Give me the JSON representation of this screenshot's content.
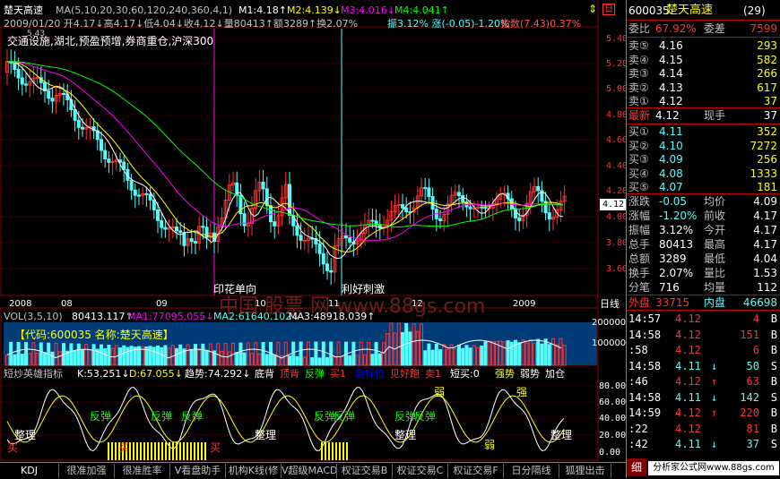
{
  "colors": {
    "up": "#ff3232",
    "down": "#54fcfc",
    "text": "#c0c0c0",
    "yellow": "#ffff00",
    "white": "#ffffff",
    "magenta": "#ff00ff",
    "green": "#00ff00",
    "grid": "#800000",
    "accent": "#ff5050"
  },
  "header": {
    "title": "楚天高速",
    "ma_label": "MA(5,10,20,30,60,120,240,360,4,1)",
    "m1": "M1:4.18↑",
    "m2": "M2:4.139↓",
    "m3": "M3:4.016↓",
    "m4": "M4:4.041↑",
    "ohlc": "2009/01/20 开4.17↓高4.17↓低4.04↓收4.12↓量80413↑额3289↑换2.07%",
    "change": "振3.12% 涨(-0.05)-1.20%",
    "index": "指数(7.43)0.37%",
    "concepts": "交通设施,湖北,预盈预增,券商重仓,沪深300",
    "topleft_val": "5.43"
  },
  "price_axis": [
    "5.40",
    "5.20",
    "5.00",
    "4.80",
    "4.60",
    "4.40",
    "4.20",
    "4.00",
    "3.80",
    "3.60"
  ],
  "current_price_tag": "4.12",
  "annotations": {
    "a1": "印花单向",
    "a2": "利好刺激"
  },
  "date_axis": [
    "2008",
    "08",
    "09",
    "10",
    "11",
    "12",
    "2009"
  ],
  "date_axis_right": "日线",
  "volume": {
    "label": "VOL(3,5,10)",
    "v": "80413.117↑",
    "ma1": "MA1:77095.055↓",
    "ma2": "MA2:61640.102↓",
    "ma3": "MA3:48918.039↑",
    "code_box": "【代码:600035 名称:楚天高速】",
    "axis": [
      "200000",
      "100000"
    ]
  },
  "watermark": "中国 股票 网 www.88gs.com",
  "indicator": {
    "name": "短炒英雄指标",
    "k": "K:53.251↓",
    "d": "D:67.055↓",
    "trend": "趋势:74.292↓",
    "labels": [
      "底背",
      "顶背",
      "反弹",
      "买1",
      "目标位",
      "见好跑",
      "卖1",
      "短买:0",
      "强势",
      "弱势",
      "加仓"
    ],
    "axis": [
      "80.00",
      "60.00",
      "40.00",
      "20.00",
      "0.00"
    ],
    "marks": [
      "反弹",
      "反弹",
      "反弹",
      "反弹",
      "反弹",
      "反弹",
      "反弹",
      "整理",
      "整理",
      "整理",
      "整理",
      "弱",
      "强",
      "弱",
      "买",
      "买",
      "买"
    ]
  },
  "tabs": [
    "KDJ",
    "很准加强",
    "很准胜率",
    "V看盘助手",
    "机构K线(修",
    "V超级MACD",
    "权证交易B",
    "权证交易C",
    "权证交易F",
    "日分隔线",
    "狐狸出击"
  ],
  "right": {
    "code": "600035",
    "name": "楚天高速",
    "count": "(29)",
    "weibi_label": "委比",
    "weibi": "67.92%",
    "weicha_label": "委差",
    "weicha": "7599",
    "sells": [
      {
        "label": "卖⑤",
        "price": "4.16",
        "vol": "293"
      },
      {
        "label": "卖④",
        "price": "4.15",
        "vol": "582"
      },
      {
        "label": "卖③",
        "price": "4.14",
        "vol": "266"
      },
      {
        "label": "卖②",
        "price": "4.13",
        "vol": "617"
      },
      {
        "label": "卖①",
        "price": "4.12",
        "vol": "37"
      }
    ],
    "latest_label": "最新",
    "latest": "4.12",
    "xianshou_label": "现手",
    "xianshou": "37",
    "buys": [
      {
        "label": "买①",
        "price": "4.11",
        "vol": "352"
      },
      {
        "label": "买②",
        "price": "4.10",
        "vol": "7272"
      },
      {
        "label": "买③",
        "price": "4.09",
        "vol": "256"
      },
      {
        "label": "买④",
        "price": "4.08",
        "vol": "1333"
      },
      {
        "label": "买⑤",
        "price": "4.07",
        "vol": "181"
      }
    ],
    "stats": [
      {
        "l1": "涨跌",
        "v1": "-0.05",
        "l2": "均价",
        "v2": "4.09"
      },
      {
        "l1": "涨幅",
        "v1": "-1.20%",
        "l2": "前收",
        "v2": "4.17"
      },
      {
        "l1": "振幅",
        "v1": "3.12%",
        "l2": "今开",
        "v2": "4.17"
      },
      {
        "l1": "总手",
        "v1": "80413",
        "l2": "最高",
        "v2": "4.17"
      },
      {
        "l1": "总额",
        "v1": "3289",
        "l2": "最低",
        "v2": "4.04"
      },
      {
        "l1": "换手",
        "v1": "2.07%",
        "l2": "量比",
        "v2": "1.53"
      },
      {
        "l1": "分笔",
        "v1": "716",
        "l2": "均量",
        "v2": "112"
      }
    ],
    "waipan_label": "外盘",
    "waipan": "33715",
    "neipan_label": "内盘",
    "neipan": "46698",
    "ticks": [
      {
        "t": "14:57",
        "p": "4.12",
        "a": "",
        "v": "4",
        "s": "B"
      },
      {
        "t": "14:58",
        "p": "4.12",
        "a": "",
        "v": "151",
        "s": "B"
      },
      {
        "t": ":58",
        "p": "4.12",
        "a": "",
        "v": "6",
        "s": "B"
      },
      {
        "t": "14:58",
        "p": "4.11",
        "a": "↓",
        "v": "50",
        "s": "S"
      },
      {
        "t": ":46",
        "p": "4.12",
        "a": "↑",
        "v": "63",
        "s": "B"
      },
      {
        "t": "14:58",
        "p": "4.11",
        "a": "↓",
        "v": "142",
        "s": "S"
      },
      {
        "t": "14:59",
        "p": "4.12",
        "a": "↑",
        "v": "220",
        "s": "B"
      },
      {
        "t": ":22",
        "p": "4.12",
        "a": "",
        "v": "81",
        "s": "B"
      },
      {
        "t": ":42",
        "p": "4.11",
        "a": "↓",
        "v": "37",
        "s": "S"
      }
    ],
    "footer_tab": "细",
    "site": "分析家公式网www.88gs.com"
  }
}
